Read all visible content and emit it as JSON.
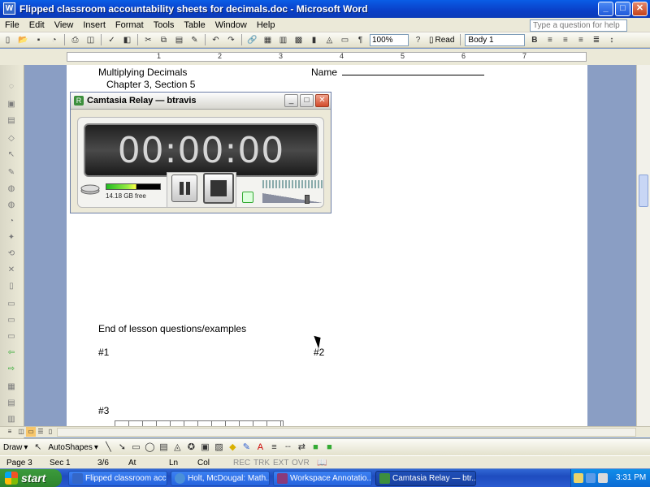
{
  "window": {
    "title": "Flipped classroom accountability sheets for decimals.doc - Microsoft Word"
  },
  "menu": {
    "items": [
      "File",
      "Edit",
      "View",
      "Insert",
      "Format",
      "Tools",
      "Table",
      "Window",
      "Help"
    ],
    "help_placeholder": "Type a question for help"
  },
  "toolbar": {
    "zoom": "100%",
    "read_label": "Read",
    "style": "Body 1"
  },
  "ruler": {
    "numbers": [
      "1",
      "2",
      "3",
      "4",
      "5",
      "6",
      "7"
    ]
  },
  "document": {
    "line1": "Multiplying Decimals",
    "name_label": "Name",
    "line2": "Chapter 3, Section 5",
    "end_heading": "End of lesson questions/examples",
    "q1": "#1",
    "q2": "#2",
    "q3": "#3"
  },
  "relay": {
    "title": "Camtasia Relay — btravis",
    "timer": "00:00:00",
    "free_space": "14.18 GB free",
    "meter_level_fraction": 0.55,
    "volume_level_fraction": 0.75
  },
  "drawbar": {
    "draw_label": "Draw",
    "autoshapes_label": "AutoShapes"
  },
  "status": {
    "page": "Page 3",
    "sec": "Sec 1",
    "pages": "3/6",
    "at": "At",
    "ln": "Ln",
    "col": "Col",
    "rec": "REC",
    "trk": "TRK",
    "ext": "EXT",
    "ovr": "OVR"
  },
  "taskbar": {
    "start_label": "start",
    "tasks": [
      "Flipped classroom acc...",
      "Holt, McDougal: Math...",
      "Workspace Annotatio...",
      "Camtasia Relay — btr..."
    ],
    "clock": "3:31 PM"
  }
}
